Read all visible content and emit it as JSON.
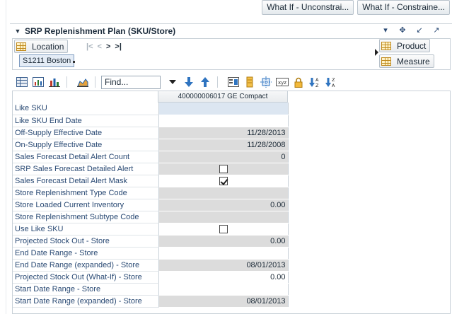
{
  "top_actions": [
    "What If - Unconstrai...",
    "What If - Constraine..."
  ],
  "panel": {
    "title": "SRP Replenishment Plan (SKU/Store)"
  },
  "pivot": {
    "location_label": "Location",
    "location_value": "S1211 Boston",
    "product_label": "Product",
    "measure_label": "Measure"
  },
  "toolbar": {
    "find_placeholder": "Find..."
  },
  "grid": {
    "column_header": "400000006017 GE Compact",
    "rows": [
      {
        "label": "Like SKU",
        "value": "",
        "style": "sel"
      },
      {
        "label": "Like SKU End Date",
        "value": "",
        "style": "white"
      },
      {
        "label": "Off-Supply Effective Date",
        "value": "11/28/2013",
        "style": "gray"
      },
      {
        "label": "On-Supply Effective Date",
        "value": "11/28/2008",
        "style": "gray"
      },
      {
        "label": "Sales Forecast Detail Alert Count",
        "value": "0",
        "style": "gray"
      },
      {
        "label": "SRP Sales Forecast Detailed Alert",
        "value": "",
        "style": "gray",
        "checkbox": false
      },
      {
        "label": "Sales Forecast Detail Alert Mask",
        "value": "",
        "style": "white",
        "checkbox": true
      },
      {
        "label": "Store Replenishment Type Code",
        "value": "",
        "style": "gray"
      },
      {
        "label": "Store Loaded Current Inventory",
        "value": "0.00",
        "style": "gray"
      },
      {
        "label": "Store Replenishment Subtype Code",
        "value": "",
        "style": "gray"
      },
      {
        "label": "Use Like SKU",
        "value": "",
        "style": "white",
        "checkbox": false
      },
      {
        "label": "Projected Stock Out - Store",
        "value": "0.00",
        "style": "gray"
      },
      {
        "label": "End Date Range - Store",
        "value": "",
        "style": "white"
      },
      {
        "label": "End Date Range (expanded) - Store",
        "value": "08/01/2013",
        "style": "gray"
      },
      {
        "label": "Projected Stock Out (What-If) - Store",
        "value": "0.00",
        "style": "white"
      },
      {
        "label": "Start Date Range - Store",
        "value": "",
        "style": "white"
      },
      {
        "label": "Start Date Range (expanded) - Store",
        "value": "08/01/2013",
        "style": "gray"
      }
    ]
  },
  "colors": {
    "label_text": "#2a4a74",
    "readonly_cell": "#dcdcdc",
    "selected_cell": "#dce6f1",
    "accent_orange": "#c08a1e"
  }
}
